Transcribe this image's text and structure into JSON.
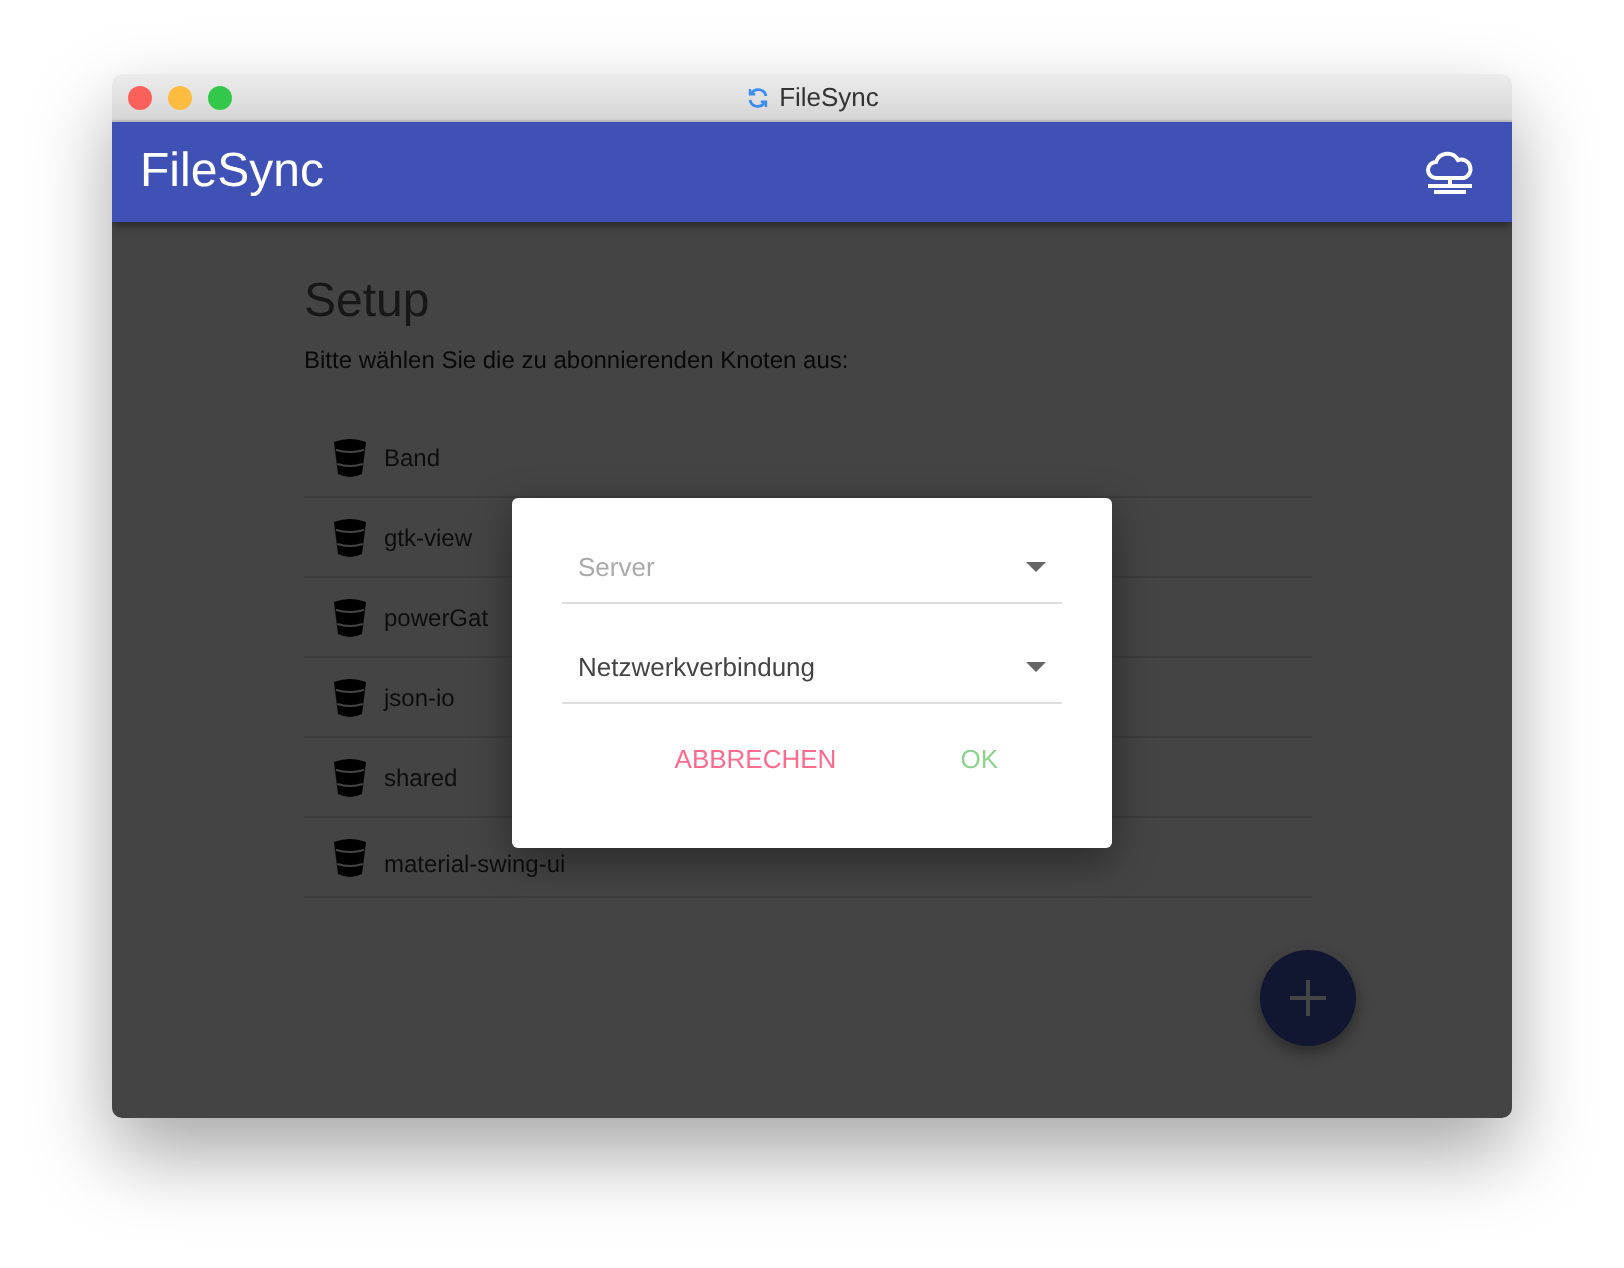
{
  "window": {
    "title": "FileSync"
  },
  "app_bar": {
    "title": "FileSync"
  },
  "setup": {
    "heading": "Setup",
    "instruction": "Bitte wählen Sie die zu abonnierenden Knoten aus:",
    "nodes": [
      "Band",
      "gtk-view",
      "powerGat",
      "json-io",
      "shared",
      "material-swing-ui"
    ]
  },
  "dialog": {
    "fields": [
      {
        "placeholder": "Server"
      },
      {
        "value": "Netzwerkverbindung"
      }
    ],
    "buttons": [
      {
        "label": "ABBRECHEN",
        "kind": "cancel"
      },
      {
        "label": "OK",
        "kind": "confirm"
      }
    ]
  }
}
